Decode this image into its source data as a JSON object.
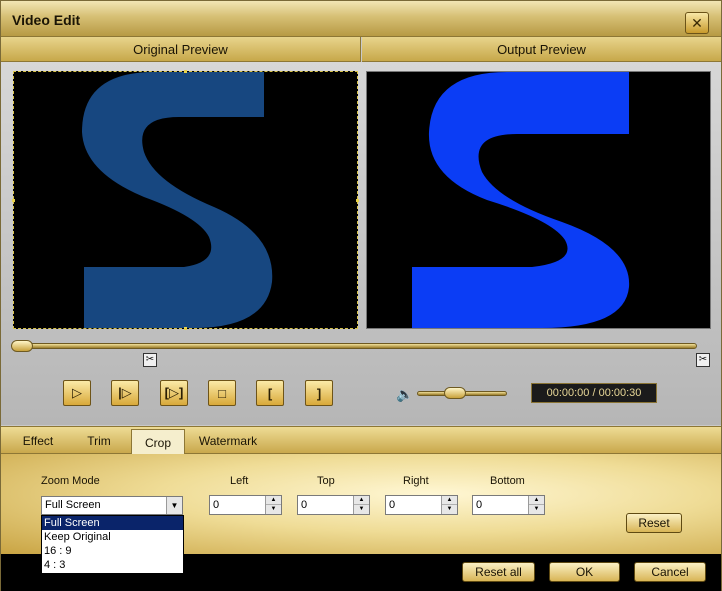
{
  "window": {
    "title": "Video Edit"
  },
  "icons": {
    "close": "close-icon",
    "volume": "volume-icon",
    "scissor": "scissor-icon"
  },
  "preview": {
    "original_label": "Original Preview",
    "output_label": "Output Preview",
    "original_letter_color": "#1a4f8e",
    "output_letter_color": "#0b3df5"
  },
  "playback": {
    "time": "00:00:00 / 00:00:30",
    "volume_level": 0.4,
    "progress": 0.0
  },
  "tabs": [
    {
      "label": "Effect"
    },
    {
      "label": "Trim"
    },
    {
      "label": "Crop",
      "active": true
    },
    {
      "label": "Watermark"
    }
  ],
  "crop": {
    "zoom_mode_label": "Zoom Mode",
    "zoom_mode_value": "Full Screen",
    "zoom_options": [
      "Full Screen",
      "Keep Original",
      "16 : 9",
      "4 : 3"
    ],
    "left_label": "Left",
    "left_value": "0",
    "top_label": "Top",
    "top_value": "0",
    "right_label": "Right",
    "right_value": "0",
    "bottom_label": "Bottom",
    "bottom_value": "0",
    "reset_label": "Reset"
  },
  "footer": {
    "reset_all_label": "Reset all",
    "ok_label": "OK",
    "cancel_label": "Cancel"
  }
}
